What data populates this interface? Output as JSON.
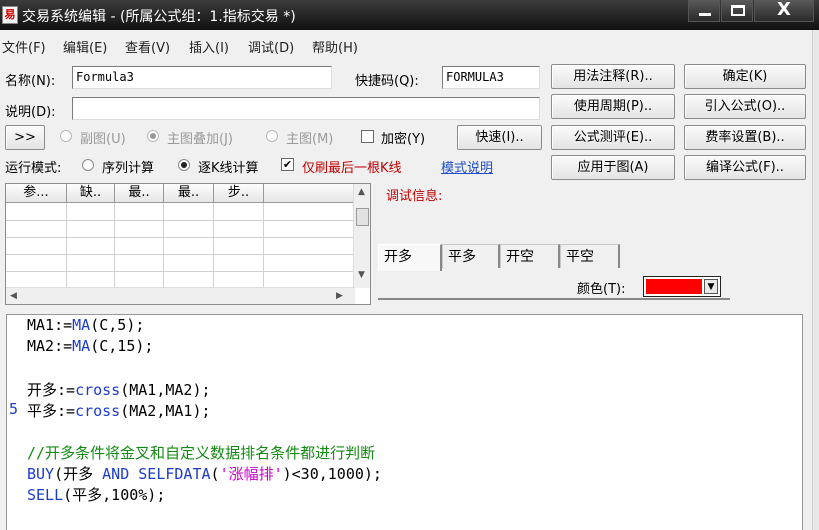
{
  "window": {
    "title": "交易系统编辑 - (所属公式组：1.指标交易 *)",
    "close_glyph": "X"
  },
  "menu": [
    "文件(F)",
    "编辑(E)",
    "查看(V)",
    "插入(I)",
    "调试(D)",
    "帮助(H)"
  ],
  "form": {
    "name_label": "名称(N):",
    "name_value": "Formula3",
    "shortcut_label": "快捷码(Q):",
    "shortcut_value": "FORMULA3",
    "desc_label": "说明(D):",
    "desc_value": ""
  },
  "buttons": {
    "usage_note": "用法注释(R)..",
    "confirm": "确定(K)",
    "use_period": "使用周期(P)..",
    "import_formula": "引入公式(O)..",
    "quick": "快速(I)..",
    "formula_test": "公式测评(E)..",
    "fee_settings": "费率设置(B)..",
    "apply_to_chart": "应用于图(A)",
    "compile": "编译公式(F)..",
    "expand": ">>"
  },
  "chart_mode": {
    "sub_chart": "副图(U)",
    "main_overlay": "主图叠加(J)",
    "main_chart": "主图(M)",
    "encrypt": "加密(Y)"
  },
  "run_mode": {
    "label": "运行模式:",
    "sequence": "序列计算",
    "per_bar": "逐K线计算",
    "refresh_last": "仅刷最后一根K线",
    "mode_help": "模式说明"
  },
  "param_table": {
    "headers": [
      "参...",
      "缺..",
      "最..",
      "最..",
      "步.."
    ]
  },
  "debug": {
    "title": "调试信息:",
    "tabs": [
      "开多",
      "平多",
      "开空",
      "平空"
    ],
    "color_label": "颜色(T):",
    "color_value": "#ff0000"
  },
  "editor": {
    "gutter_marker": "5",
    "lines": [
      [
        {
          "t": "MA1:=",
          "c": ""
        },
        {
          "t": "MA",
          "c": "kw"
        },
        {
          "t": "(C,5);",
          "c": ""
        }
      ],
      [
        {
          "t": "MA2:=",
          "c": ""
        },
        {
          "t": "MA",
          "c": "kw"
        },
        {
          "t": "(C,15);",
          "c": ""
        }
      ],
      [],
      [
        {
          "t": "开多:=",
          "c": ""
        },
        {
          "t": "cross",
          "c": "kw"
        },
        {
          "t": "(MA1,MA2);",
          "c": ""
        }
      ],
      [
        {
          "t": "平多:=",
          "c": ""
        },
        {
          "t": "cross",
          "c": "kw"
        },
        {
          "t": "(MA2,MA1);",
          "c": ""
        }
      ],
      [],
      [
        {
          "t": "//开多条件将金叉和自定义数据排名条件都进行判断",
          "c": "cmt"
        }
      ],
      [
        {
          "t": "BUY",
          "c": "kw"
        },
        {
          "t": "(开多 ",
          "c": ""
        },
        {
          "t": "AND SELFDATA",
          "c": "kw"
        },
        {
          "t": "(",
          "c": ""
        },
        {
          "t": "'涨幅排'",
          "c": "str"
        },
        {
          "t": ")<30,1000);",
          "c": ""
        }
      ],
      [
        {
          "t": "SELL",
          "c": "kw"
        },
        {
          "t": "(平多,100%);",
          "c": ""
        }
      ]
    ]
  }
}
